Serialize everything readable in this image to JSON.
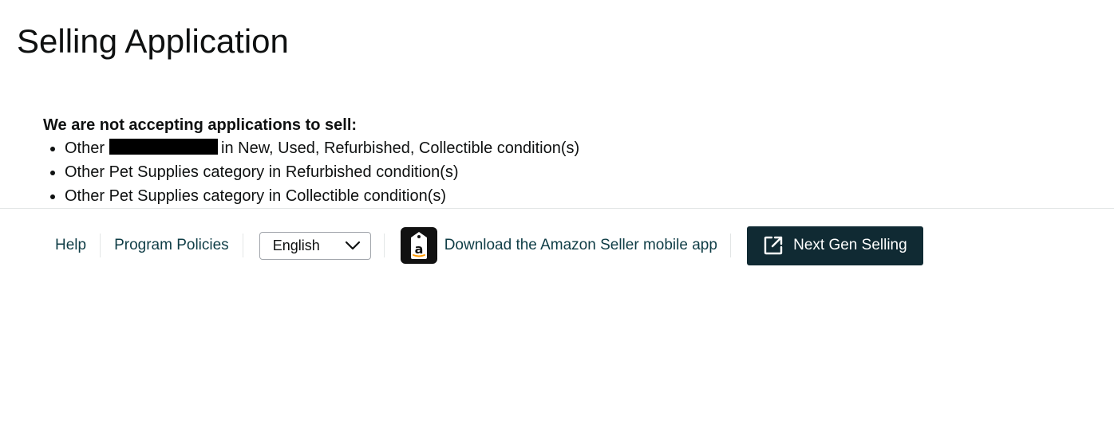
{
  "page": {
    "title": "Selling Application"
  },
  "notice": {
    "heading": "We are not accepting applications to sell:",
    "items": [
      {
        "prefix": "Other",
        "suffix": "in New, Used, Refurbished, Collectible condition(s)"
      },
      {
        "text": "Other Pet Supplies category in Refurbished condition(s)"
      },
      {
        "text": "Other Pet Supplies category in Collectible condition(s)"
      }
    ]
  },
  "footer": {
    "help_label": "Help",
    "policies_label": "Program Policies",
    "language": {
      "selected": "English"
    },
    "app_link_label": "Download the Amazon Seller mobile app",
    "next_gen_label": "Next Gen Selling"
  },
  "icons": {
    "app": "amazon-seller-app-icon",
    "next_gen": "external-link-icon",
    "select": "chevron-down-icon"
  },
  "colors": {
    "link": "#0f3d46",
    "button_bg": "#102a33",
    "redaction": "#000000"
  }
}
